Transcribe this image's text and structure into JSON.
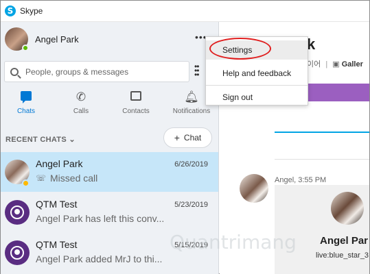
{
  "window": {
    "title": "Skype"
  },
  "profile": {
    "name": "Angel Park"
  },
  "search": {
    "placeholder": "People, groups & messages"
  },
  "tabs": [
    {
      "label": "Chats",
      "icon": "chat-icon",
      "active": true
    },
    {
      "label": "Calls",
      "icon": "phone-icon",
      "active": false
    },
    {
      "label": "Contacts",
      "icon": "contacts-icon",
      "active": false
    },
    {
      "label": "Notifications",
      "icon": "bell-icon",
      "active": false
    }
  ],
  "recent": {
    "label": "RECENT CHATS",
    "new_chat_label": "Chat"
  },
  "chats": [
    {
      "name": "Angel Park",
      "date": "6/26/2019",
      "preview": "Missed call"
    },
    {
      "name": "QTM Test",
      "date": "5/23/2019",
      "preview": "Angel Park has left this conv..."
    },
    {
      "name": "QTM Test",
      "date": "5/15/2019",
      "preview": "Angel Park added MrJ to thi..."
    }
  ],
  "menu": {
    "items": [
      {
        "label": "Settings"
      },
      {
        "label": "Help and feedback"
      },
      {
        "label": "Sign out"
      }
    ]
  },
  "main": {
    "title_fragment": "k",
    "subtitle_fragment": "이어",
    "gallery_label": "Galler",
    "message_meta": "Angel, 3:55 PM",
    "card_name": "Angel Par",
    "card_id": "live:blue_star_3"
  },
  "watermark": {
    "text": "Quantrimang"
  },
  "colors": {
    "accent": "#0078d4",
    "selected_row": "#c6e6f9",
    "presence_online": "#5bb900",
    "highlight_ring": "#e01e1e"
  }
}
